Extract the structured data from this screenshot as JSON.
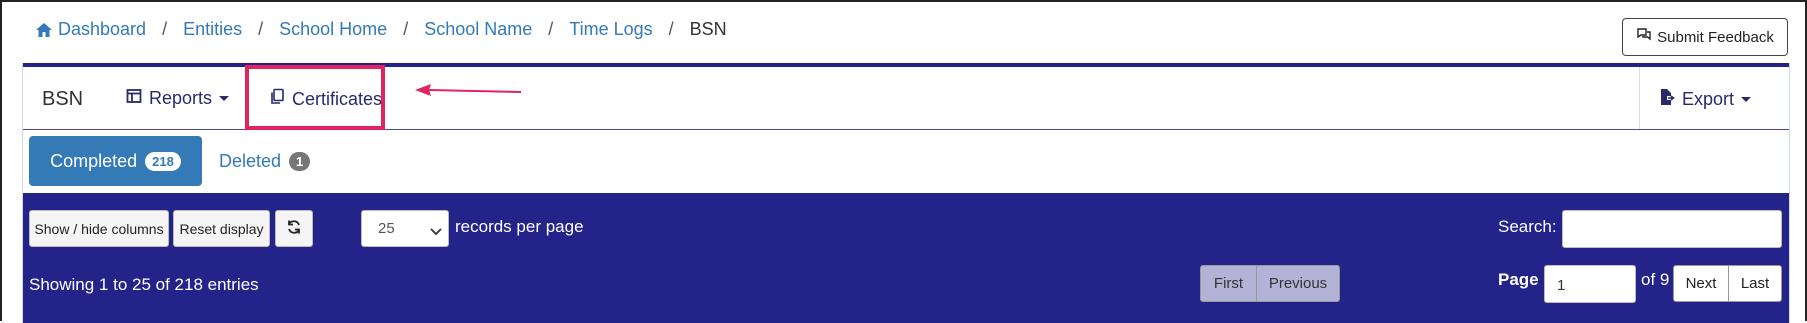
{
  "breadcrumb": {
    "items": [
      "Dashboard",
      "Entities",
      "School Home",
      "School Name",
      "Time Logs"
    ],
    "current": "BSN",
    "separator": "/"
  },
  "feedback": {
    "label": "Submit Feedback"
  },
  "navbar": {
    "title": "BSN",
    "reports_label": "Reports",
    "certificates_label": "Certificates",
    "export_label": "Export"
  },
  "tabs": {
    "completed": {
      "label": "Completed",
      "count": "218"
    },
    "deleted": {
      "label": "Deleted",
      "count": "1"
    }
  },
  "controls": {
    "show_hide_label": "Show / hide columns",
    "reset_label": "Reset display",
    "page_size": "25",
    "records_label": "records per page",
    "search_label": "Search:"
  },
  "pagination": {
    "showing": "Showing 1 to 25 of 218 entries",
    "first": "First",
    "previous": "Previous",
    "page_label": "Page",
    "page_value": "1",
    "of_label": "of 9",
    "next": "Next",
    "last": "Last"
  },
  "colors": {
    "link": "#337ab7",
    "toolbar_bg": "#232389",
    "highlight": "#e0245e"
  },
  "icons": [
    "home-icon",
    "feedback-icon",
    "reports-icon",
    "certificates-icon",
    "export-icon",
    "refresh-icon",
    "chevron-down-icon"
  ]
}
